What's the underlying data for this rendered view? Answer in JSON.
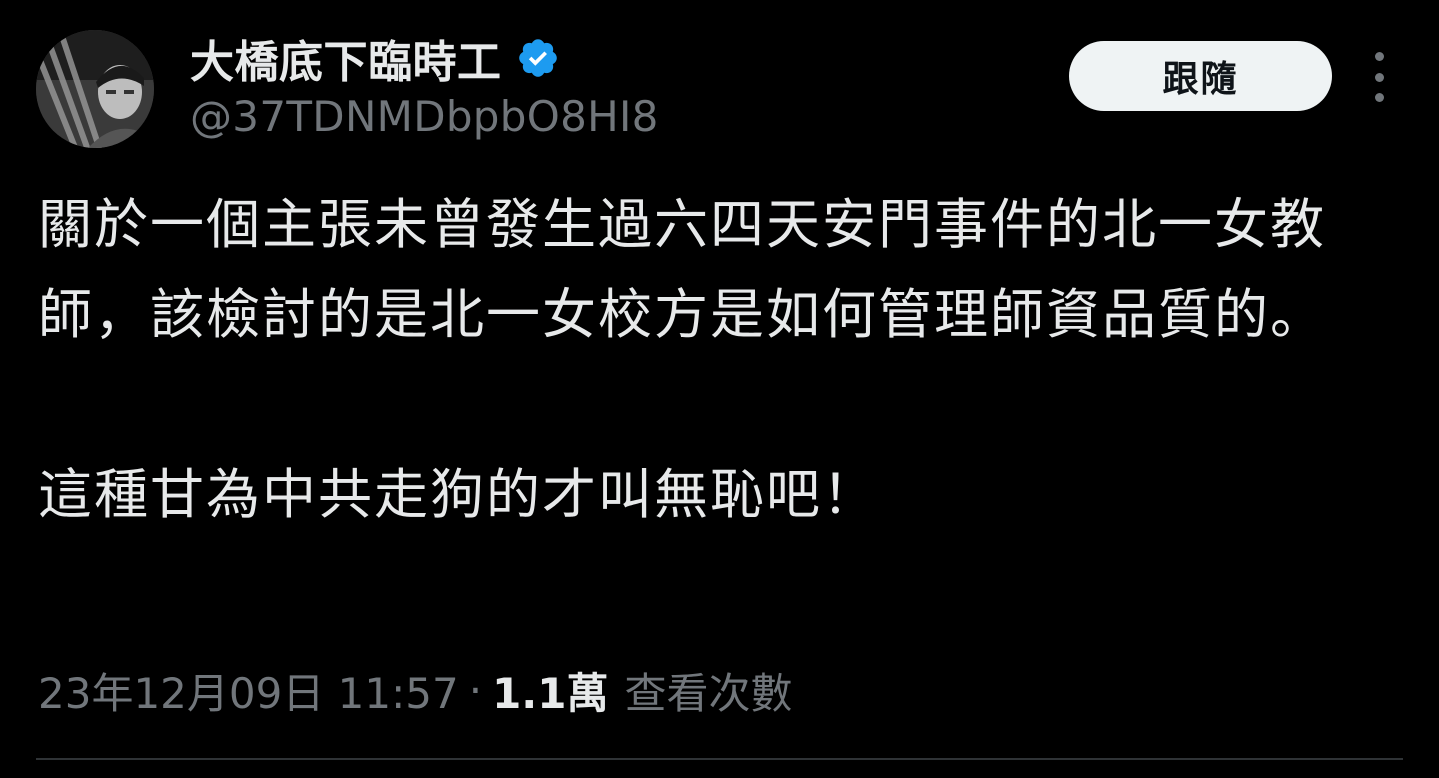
{
  "author": {
    "display_name": "大橋底下臨時工",
    "handle": "@37TDNMDbpbO8HI8",
    "verified": true,
    "avatar_icon": "profile-photo"
  },
  "header": {
    "follow_label": "跟隨",
    "more_icon": "more-vertical-icon"
  },
  "tweet": {
    "paragraph_1": "關於一個主張未曾發生過六四天安門事件的北一女教師，該檢討的是北一女校方是如何管理師資品質的。",
    "paragraph_2": "這種甘為中共走狗的才叫無恥吧！"
  },
  "meta": {
    "timestamp": "23年12月09日 11:57",
    "separator": "·",
    "view_count": "1.1萬",
    "view_label": "查看次數"
  },
  "colors": {
    "background": "#000000",
    "primary_text": "#e7e9ea",
    "secondary_text": "#71767b",
    "verified_blue": "#1d9bf0",
    "button_bg": "#eff3f4"
  }
}
